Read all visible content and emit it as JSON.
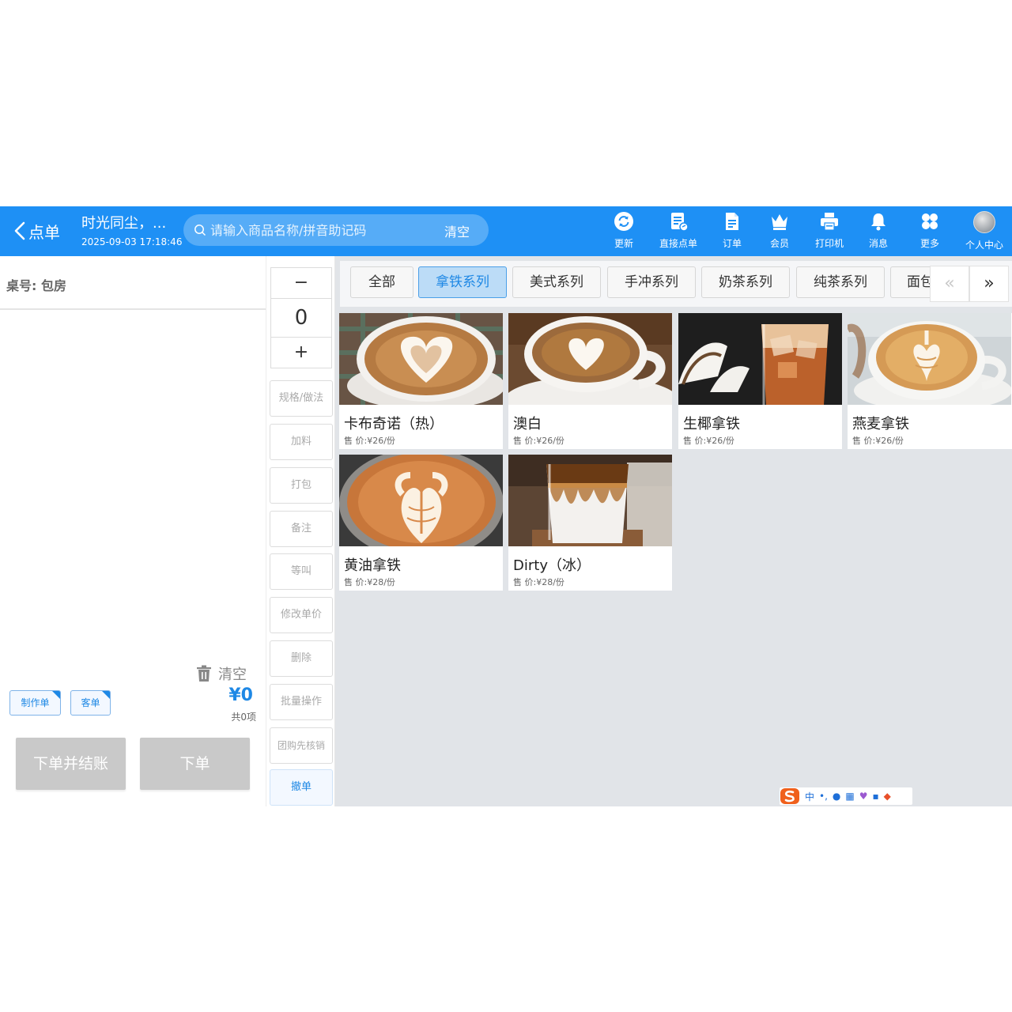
{
  "header": {
    "back_label": "点单",
    "shop_name": "时光同尘，...",
    "datetime": "2025-09-03 17:18:46",
    "search": {
      "placeholder": "请输入商品名称/拼音助记码",
      "clear_label": "清空"
    },
    "actions": [
      {
        "label": "更新",
        "icon": "refresh-icon"
      },
      {
        "label": "直接点单",
        "icon": "direct-order-icon"
      },
      {
        "label": "订单",
        "icon": "order-document-icon"
      },
      {
        "label": "会员",
        "icon": "crown-icon"
      },
      {
        "label": "打印机",
        "icon": "printer-icon"
      },
      {
        "label": "消息",
        "icon": "bell-icon"
      },
      {
        "label": "更多",
        "icon": "grid-more-icon"
      },
      {
        "label": "个人中心",
        "icon": "avatar"
      }
    ],
    "colors": {
      "bar": "#1e90f5",
      "accent": "#1e88e5"
    }
  },
  "order": {
    "table_label": "桌号: 包房",
    "clear_label": "清空",
    "tags": [
      "制作单",
      "客单"
    ],
    "total": "¥0",
    "count": "共0项",
    "submit_pay_label": "下单并结账",
    "submit_label": "下单"
  },
  "quantity": {
    "minus": "−",
    "value": "0",
    "plus": "+"
  },
  "actions": [
    "规格/做法",
    "加料",
    "打包",
    "备注",
    "等叫",
    "修改单价",
    "删除",
    "批量操作",
    "团购先核销",
    "撤单"
  ],
  "categories": {
    "tabs": [
      "全部",
      "拿铁系列",
      "美式系列",
      "手冲系列",
      "奶茶系列",
      "纯茶系列",
      "面包"
    ],
    "active": "拿铁系列",
    "prev_label": "«",
    "next_label": "»"
  },
  "products": [
    {
      "name": "卡布奇诺（热）",
      "price": "售 价:¥26/份"
    },
    {
      "name": "澳白",
      "price": "售 价:¥26/份"
    },
    {
      "name": "生椰拿铁",
      "price": "售 价:¥26/份"
    },
    {
      "name": "燕麦拿铁",
      "price": "售 价:¥26/份"
    },
    {
      "name": "黄油拿铁",
      "price": "售 价:¥28/份"
    },
    {
      "name": "Dirty（冰）",
      "price": "售 价:¥28/份"
    }
  ],
  "ime": {
    "mode": "中"
  }
}
